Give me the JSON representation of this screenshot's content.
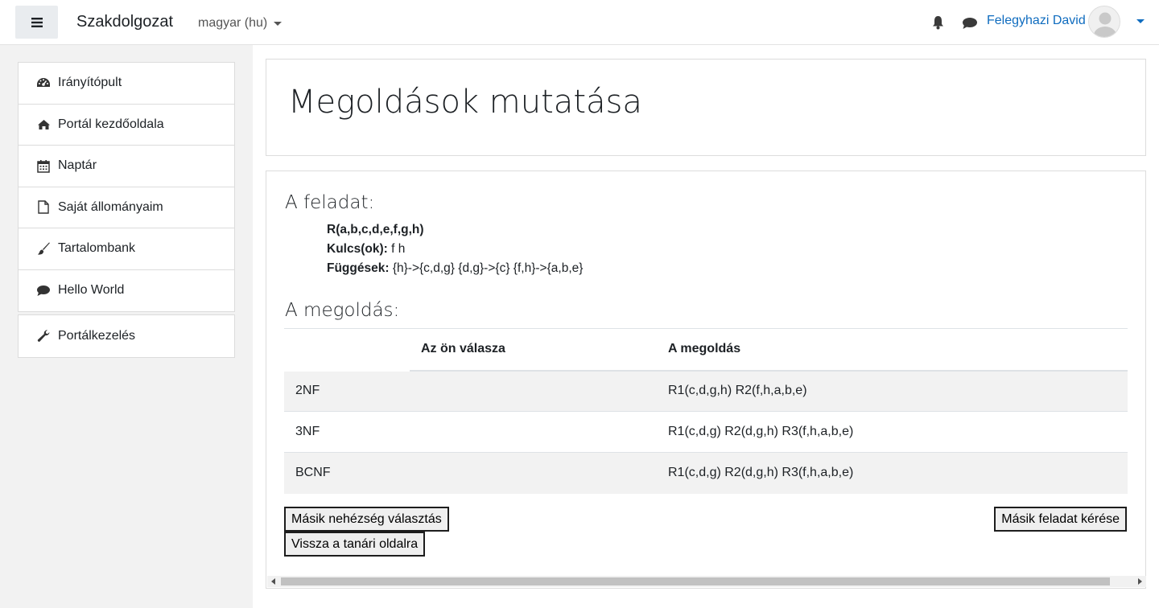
{
  "navbar": {
    "site_name": "Szakdolgozat",
    "language": "magyar (hu)",
    "user_name": "Felegyhazi David"
  },
  "sidebar": {
    "items": [
      {
        "label": "Irányítópult",
        "icon": "dashboard-icon"
      },
      {
        "label": "Portál kezdőoldala",
        "icon": "home-icon"
      },
      {
        "label": "Naptár",
        "icon": "calendar-icon"
      },
      {
        "label": "Saját állományaim",
        "icon": "file-icon"
      },
      {
        "label": "Tartalombank",
        "icon": "brush-icon"
      },
      {
        "label": "Hello World",
        "icon": "comment-icon"
      }
    ],
    "admin": {
      "label": "Portálkezelés",
      "icon": "wrench-icon"
    }
  },
  "page": {
    "title": "Megoldások mutatása"
  },
  "task": {
    "heading": "A feladat:",
    "relation": "R(a,b,c,d,e,f,g,h)",
    "keys_label": "Kulcs(ok):",
    "keys_value": " f h",
    "deps_label": "Függések:",
    "deps_value": " {h}->{c,d,g} {d,g}->{c} {f,h}->{a,b,e}"
  },
  "solution": {
    "heading": "A megoldás:",
    "columns": [
      "",
      "Az ön válasza",
      "A megoldás"
    ],
    "rows": [
      {
        "form": "2NF",
        "answer": "",
        "solution": "R1(c,d,g,h) R2(f,h,a,b,e)"
      },
      {
        "form": "3NF",
        "answer": "",
        "solution": "R1(c,d,g) R2(d,g,h) R3(f,h,a,b,e)"
      },
      {
        "form": "BCNF",
        "answer": "",
        "solution": "R1(c,d,g) R2(d,g,h) R3(f,h,a,b,e)"
      }
    ]
  },
  "buttons": {
    "other_difficulty": "Másik nehézség választás",
    "back_teacher": "Vissza a tanári oldalra",
    "other_task": "Másik feladat kérése"
  },
  "colors": {
    "link": "#0f6cbf",
    "sidebar_bg": "#f2f2f2",
    "striped_row": "#f2f2f2"
  }
}
